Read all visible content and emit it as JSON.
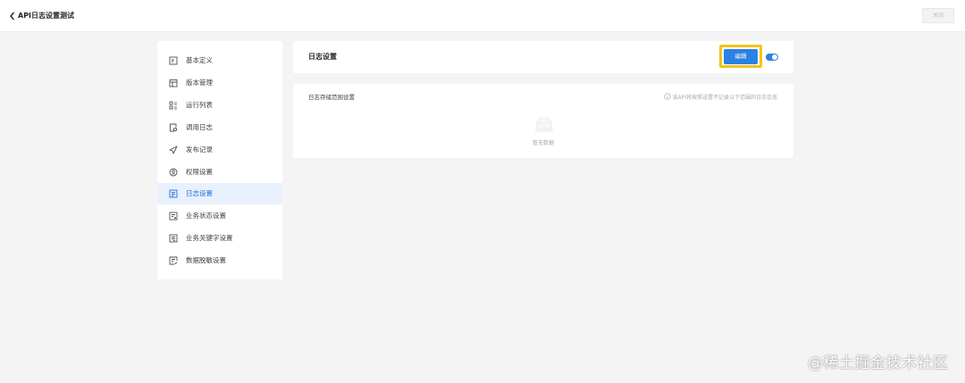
{
  "header": {
    "back_icon": "chevron-left-icon",
    "title": "API日志设置测试",
    "close_label": "关闭"
  },
  "sidebar": {
    "items": [
      {
        "label": "基本定义",
        "icon": "document-icon",
        "active": false
      },
      {
        "label": "版本管理",
        "icon": "calendar-icon",
        "active": false
      },
      {
        "label": "运行列表",
        "icon": "grid-list-icon",
        "active": false
      },
      {
        "label": "调用日志",
        "icon": "file-search-icon",
        "active": false
      },
      {
        "label": "发布记录",
        "icon": "send-icon",
        "active": false
      },
      {
        "label": "权限设置",
        "icon": "user-circle-icon",
        "active": false
      },
      {
        "label": "日志设置",
        "icon": "log-settings-icon",
        "active": true
      },
      {
        "label": "业务状态设置",
        "icon": "status-doc-icon",
        "active": false
      },
      {
        "label": "业务关键字设置",
        "icon": "keyword-doc-icon",
        "active": false
      },
      {
        "label": "数据脱敏设置",
        "icon": "mask-doc-icon",
        "active": false
      }
    ]
  },
  "main": {
    "section_title": "日志设置",
    "edit_label": "编辑",
    "toggle_on": true,
    "storage": {
      "title": "日志存储范围设置",
      "hint": "该API将按照设置不记录以下范围的日志信息",
      "empty_text": "暂无数据"
    }
  },
  "watermark": "@稀土掘金技术社区",
  "colors": {
    "accent": "#2a82e4",
    "highlight_frame": "#f4c21b",
    "active_bg": "#e8f1fd",
    "background": "#f4f4f5"
  }
}
